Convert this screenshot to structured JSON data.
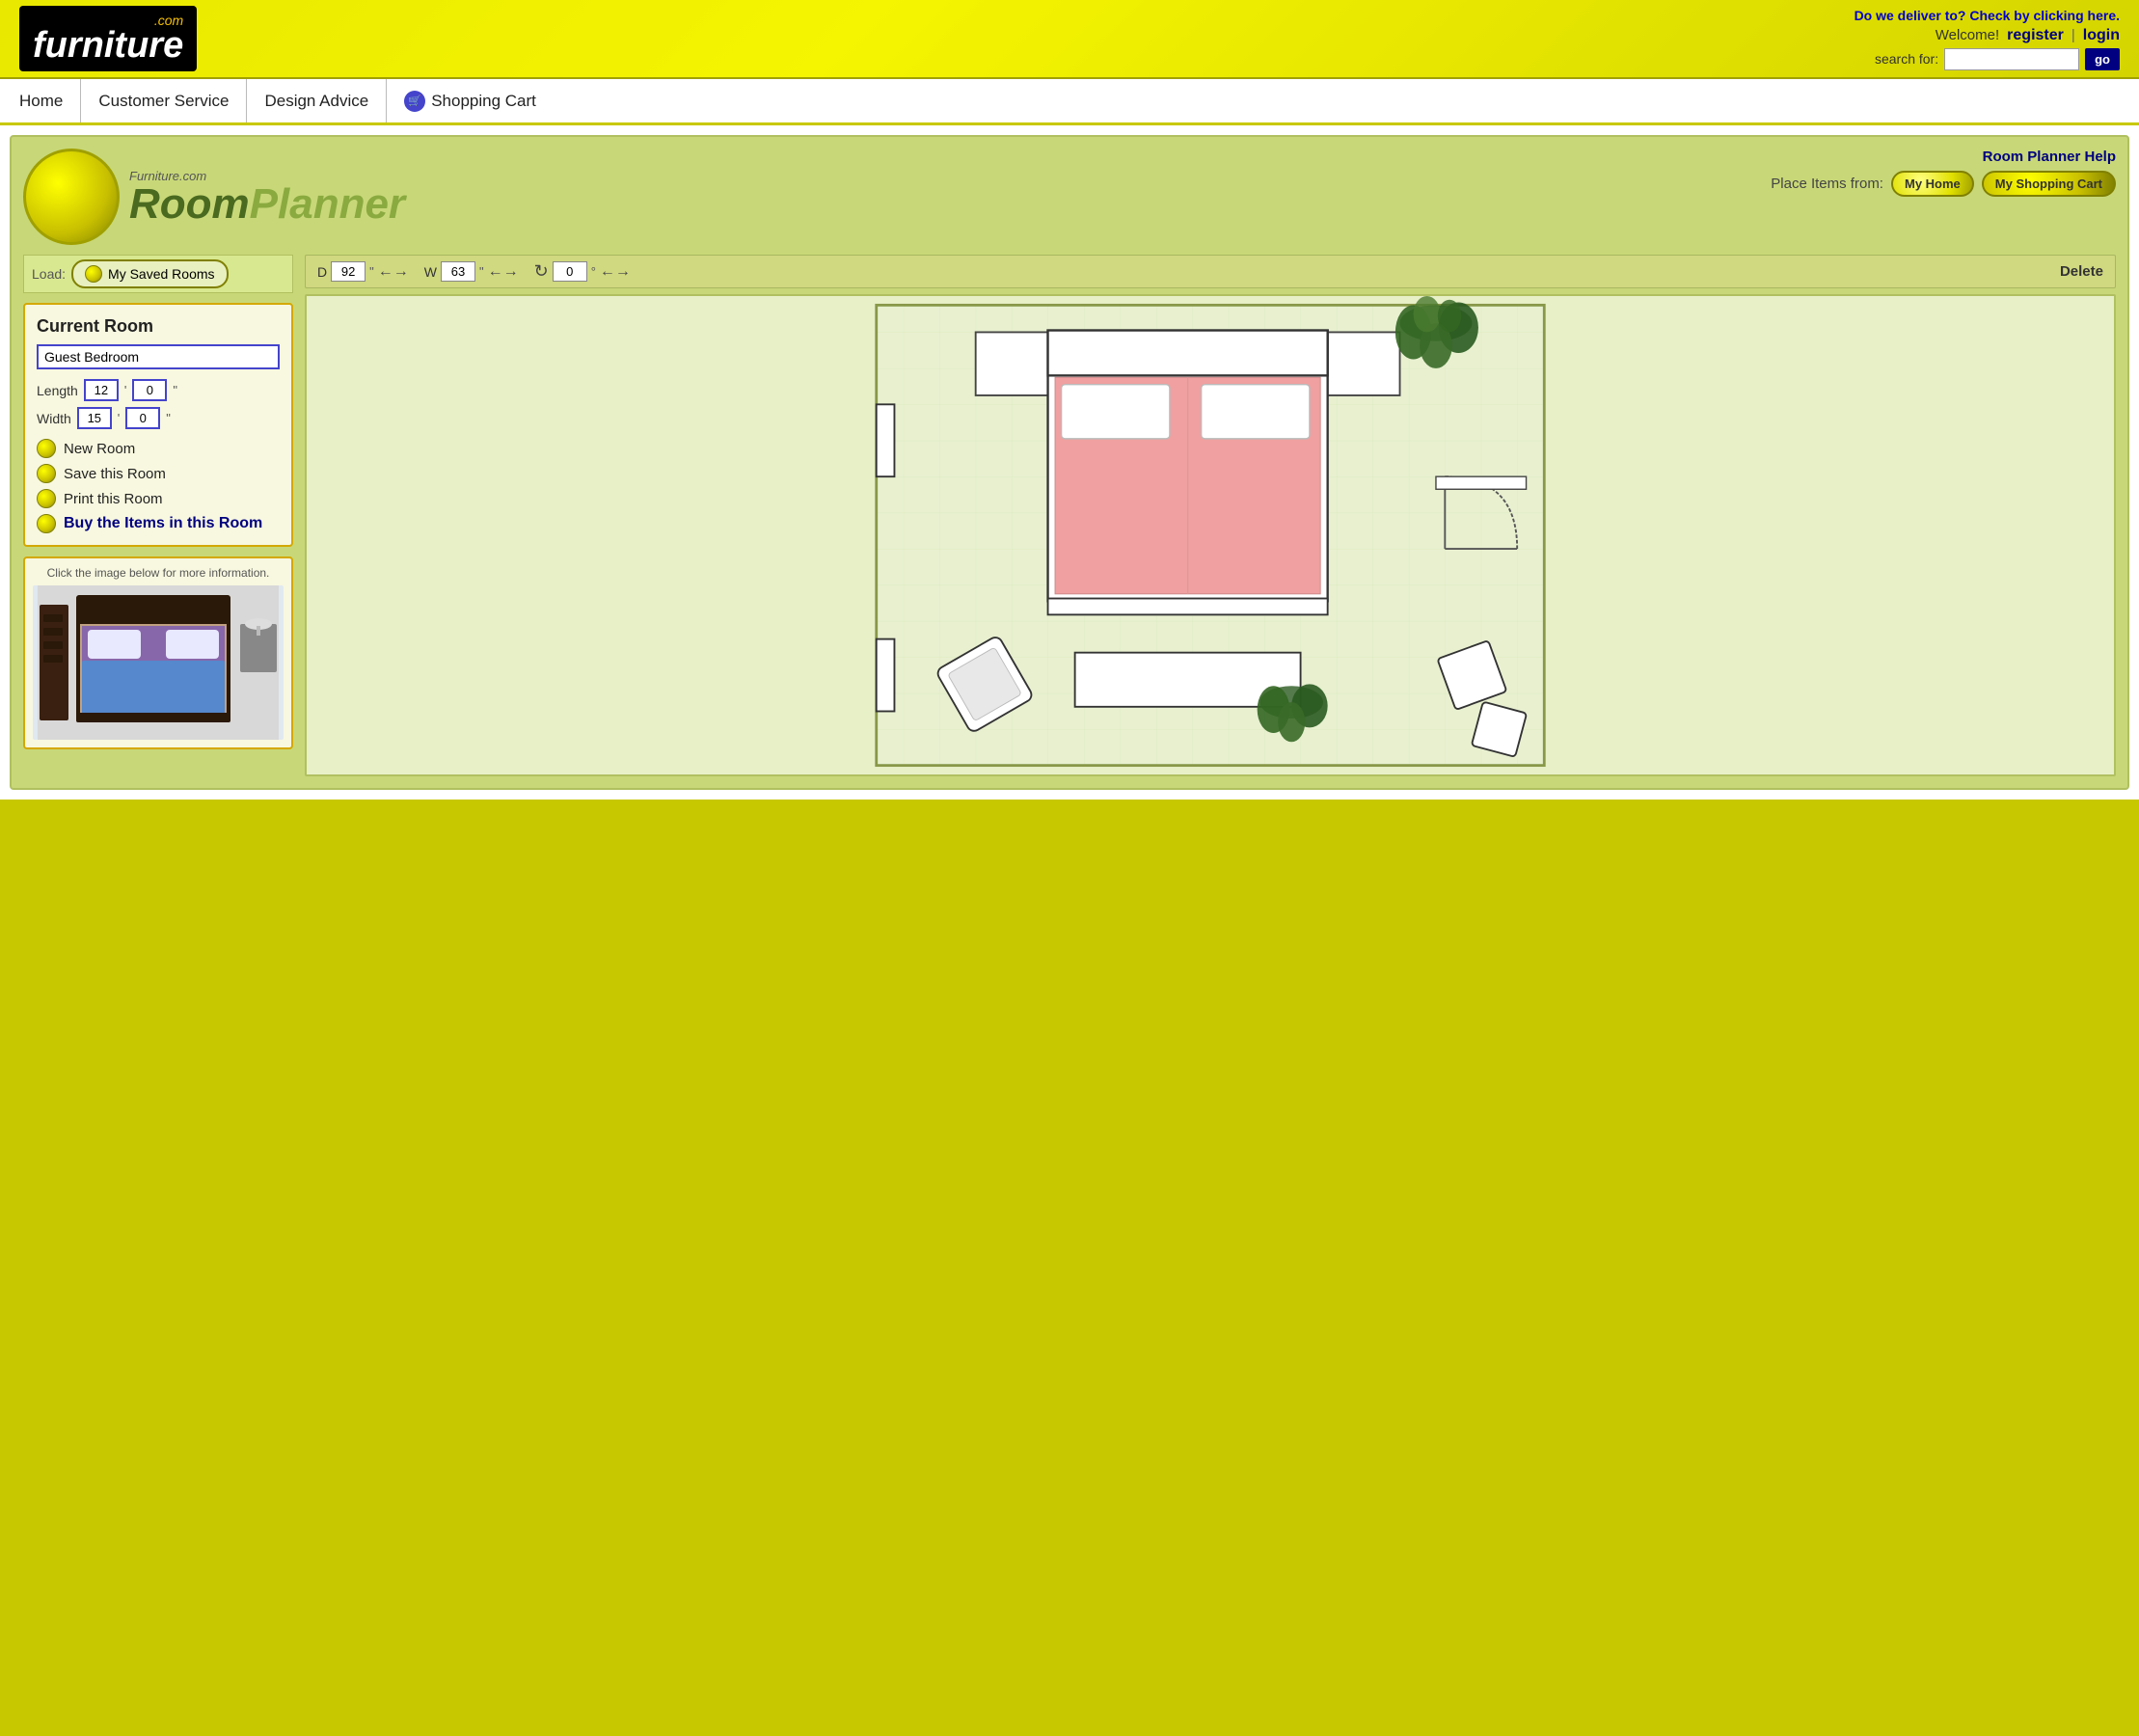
{
  "site": {
    "logo_com": ".com",
    "logo_name": "furniture",
    "delivery_text": "Do we deliver to?",
    "delivery_link": "Check by clicking here.",
    "welcome_text": "Welcome!",
    "register_label": "register",
    "login_label": "login",
    "search_label": "search for:",
    "search_placeholder": "",
    "go_label": "go"
  },
  "nav": {
    "items": [
      {
        "label": "Home",
        "id": "home"
      },
      {
        "label": "Customer Service",
        "id": "customer-service"
      },
      {
        "label": "Design Advice",
        "id": "design-advice"
      },
      {
        "label": "Shopping Cart",
        "id": "shopping-cart"
      }
    ]
  },
  "planner": {
    "logo_site_name": "Furniture.com",
    "logo_title": "RoomPlanner",
    "help_link": "Room Planner Help",
    "place_items_label": "Place Items from:",
    "my_home_btn": "My Home",
    "my_shopping_cart_btn": "My Shopping Cart",
    "load_label": "Load:",
    "my_saved_rooms_btn": "My Saved Rooms",
    "current_room_title": "Current Room",
    "room_name_value": "Guest Bedroom",
    "length_label": "Length",
    "length_ft": "12",
    "length_in": "0",
    "width_label": "Width",
    "width_ft": "15",
    "width_in": "0",
    "inch_unit": "\"",
    "new_room_label": "New Room",
    "save_room_label": "Save this Room",
    "print_room_label": "Print this Room",
    "buy_items_label": "Buy the Items in this Room",
    "info_panel_text": "Click the image below for more information.",
    "toolbar": {
      "depth_label": "D",
      "depth_value": "92",
      "width_label": "W",
      "width_value": "63",
      "rotation_value": "0",
      "delete_label": "Delete"
    }
  }
}
